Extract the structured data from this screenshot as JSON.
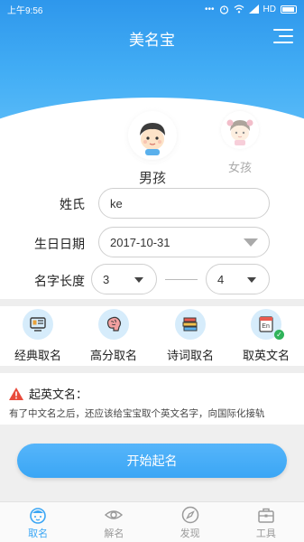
{
  "status_bar": {
    "time": "上午9:56",
    "network": "HD"
  },
  "header": {
    "title": "美名宝"
  },
  "gender": {
    "boy": "男孩",
    "girl": "女孩",
    "selected": "boy"
  },
  "form": {
    "surname_label": "姓氏",
    "surname_value": "ke",
    "birthday_label": "生日日期",
    "birthday_value": "2017-10-31",
    "length_label": "名字长度",
    "length_min": "3",
    "length_max": "4"
  },
  "features": [
    {
      "label": "经典取名",
      "icon": "classic-name-icon"
    },
    {
      "label": "高分取名",
      "icon": "brain-icon"
    },
    {
      "label": "诗词取名",
      "icon": "books-icon"
    },
    {
      "label": "取英文名",
      "icon": "english-name-icon"
    }
  ],
  "tip": {
    "title": "起英文名：",
    "text": "有了中文名之后，还应该给宝宝取个英文名字，向国际化接轨"
  },
  "start_button": "开始起名",
  "tabs": [
    {
      "label": "取名",
      "active": true
    },
    {
      "label": "解名",
      "active": false
    },
    {
      "label": "发现",
      "active": false
    },
    {
      "label": "工具",
      "active": false
    }
  ],
  "colors": {
    "primary": "#3aa6f5",
    "header_top": "#2e97ec",
    "warning": "#e84b3c"
  }
}
